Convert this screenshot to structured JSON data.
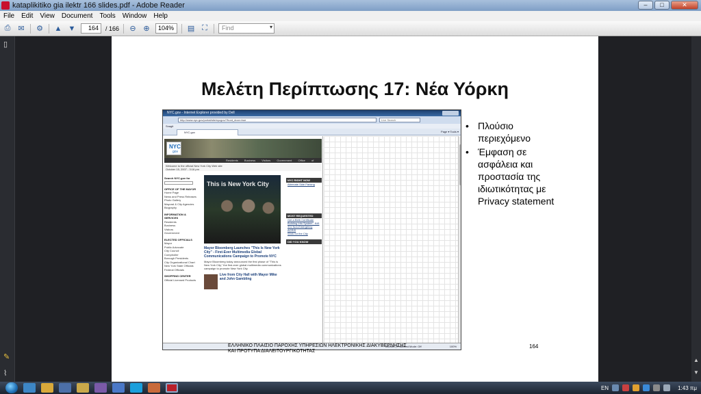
{
  "window": {
    "title": "kataplikitiko gia ilektr 166 slides.pdf - Adobe Reader",
    "controls": [
      "–",
      "□",
      "✕"
    ]
  },
  "menu": [
    "File",
    "Edit",
    "View",
    "Document",
    "Tools",
    "Window",
    "Help"
  ],
  "toolbar": {
    "page_current": "164",
    "page_total": "/ 166",
    "zoom": "104%",
    "find_placeholder": "Find"
  },
  "slide": {
    "title": "Μελέτη Περίπτωσης 17: Νέα Υόρκη",
    "bullets": [
      "Πλούσιο περιεχόμενο",
      "Έμφαση σε ασφάλεια και προστασία της ιδιωτικότητας με Privacy statement"
    ],
    "footer_line1": "ΕΛΛΗΝΙΚΟ ΠΛΑΙΣΙΟ ΠΑΡΟΧΗΣ ΥΠΗΡΕΣΙΩΝ ΗΛΕΚΤΡΟΝΙΚΗΣ ΔΙΑΚΥΒΕΡΝΗΣΗΣ",
    "footer_line2": "ΚΑΙ ΠΡΟΤΥΠΑ ΔΙΑΛΕΙΤΟΥΡΓΙΚΟΤΗΤΑΣ",
    "page_number": "164"
  },
  "screenshot": {
    "browser_title": "NYC.gov - Internet Explorer provided by Dell",
    "url": "http://www.nyc.gov/portal/site/nycgov/?front_door=true",
    "search": "Live Search",
    "links_bar": "Snagit",
    "tab_label": "NYC.gov",
    "tools": "Page ▾  Tools ▾",
    "status": "Internet | Protected Mode: Off",
    "status_zoom": "100%",
    "nyc": {
      "logo_nyc": "NYC",
      "logo_gov": "gov",
      "nav": "Residents Business Visitors Government Office of the Mayor",
      "welcome": "Welcome to the official New York City Web site",
      "date": "October 15, 2007 - 3:16 pm",
      "sidebar_search": "Search NYC.gov for",
      "sidebar_sections": [
        {
          "heading": "OFFICE OF THE MAYOR",
          "items": [
            "Home Page",
            "News and Press Releases",
            "Photo Gallery",
            "Mayoral & City Agencies",
            "Biography"
          ]
        },
        {
          "heading": "INFORMATION & SERVICES",
          "items": [
            "Residents",
            "Business",
            "Visitors",
            "Government"
          ]
        },
        {
          "heading": "ELECTED OFFICIALS",
          "items": [
            "Mayor",
            "Public Advocate",
            "City Council",
            "Comptroller",
            "Borough Presidents",
            "City Organizational Chart",
            "New York State Officials",
            "Federal Officials"
          ]
        },
        {
          "heading": "SHOPPING CENTER",
          "items": [
            "Official Licensed Products"
          ]
        }
      ],
      "photo_banner": "This is New York City",
      "headline": "Mayor Bloomberg Launches \"This Is New York City\" - First-Ever Multimedia Global Communications Campaign to Promote NYC",
      "body": "Mayor Bloomberg today announced the first phase of \"This is New York City,\" the first-ever global multimedia communications campaign to promote New York City.",
      "second_headline": "Live from City Hall with Mayor Mike and John Gambling",
      "right_boxes": [
        "NYC RIGHT NOW",
        "MOST REQUESTED",
        "DID YOU KNOW"
      ],
      "right_links": [
        "Alternate Side Parking",
        "Get a Birth Certificate",
        "Building Info System - BIS",
        "311 Non-Emergency",
        "ACRIS",
        "Work for the City"
      ]
    }
  },
  "taskbar": {
    "language": "EN",
    "clock": "1:43 πμ"
  }
}
